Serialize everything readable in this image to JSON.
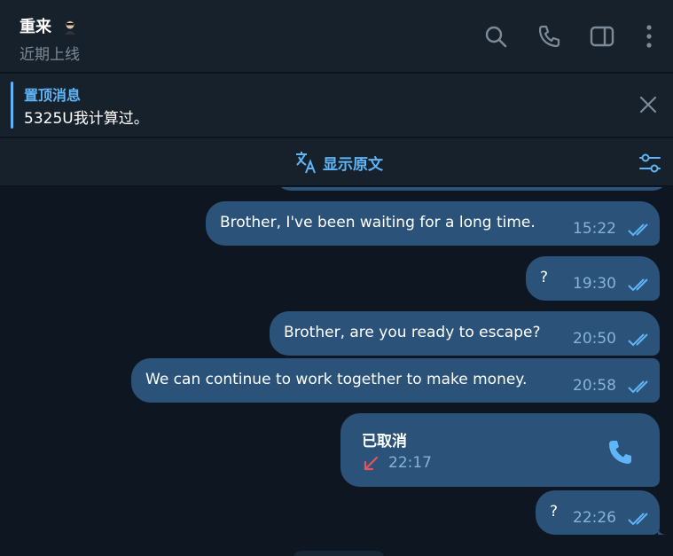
{
  "header": {
    "title": "重来",
    "status": "近期上线",
    "icons": [
      "search-icon",
      "phone-icon",
      "sidebar-toggle-icon",
      "more-vertical-icon"
    ]
  },
  "pinned": {
    "title": "置顶消息",
    "text": "5325U我计算过。"
  },
  "translate": {
    "label": "显示原文"
  },
  "messages": [
    {
      "text": "Brother, I've been waiting for a long time.",
      "time": "15:22",
      "read": true
    },
    {
      "text": "?",
      "time": "19:30",
      "read": true
    },
    {
      "text": "Brother, are you ready to escape?",
      "time": "20:50",
      "read": true
    },
    {
      "text": "We can continue to work together to make money.",
      "time": "20:58",
      "read": true
    },
    {
      "type": "call",
      "title": "已取消",
      "time": "22:17",
      "status": "missed"
    },
    {
      "text": "?",
      "time": "22:26",
      "read": true
    }
  ],
  "colors": {
    "background": "#0e1621",
    "panel": "#17212b",
    "bubble_out": "#2b5278",
    "accent": "#5eb5f7",
    "time": "#86b3d8",
    "missed": "#e0565b"
  }
}
